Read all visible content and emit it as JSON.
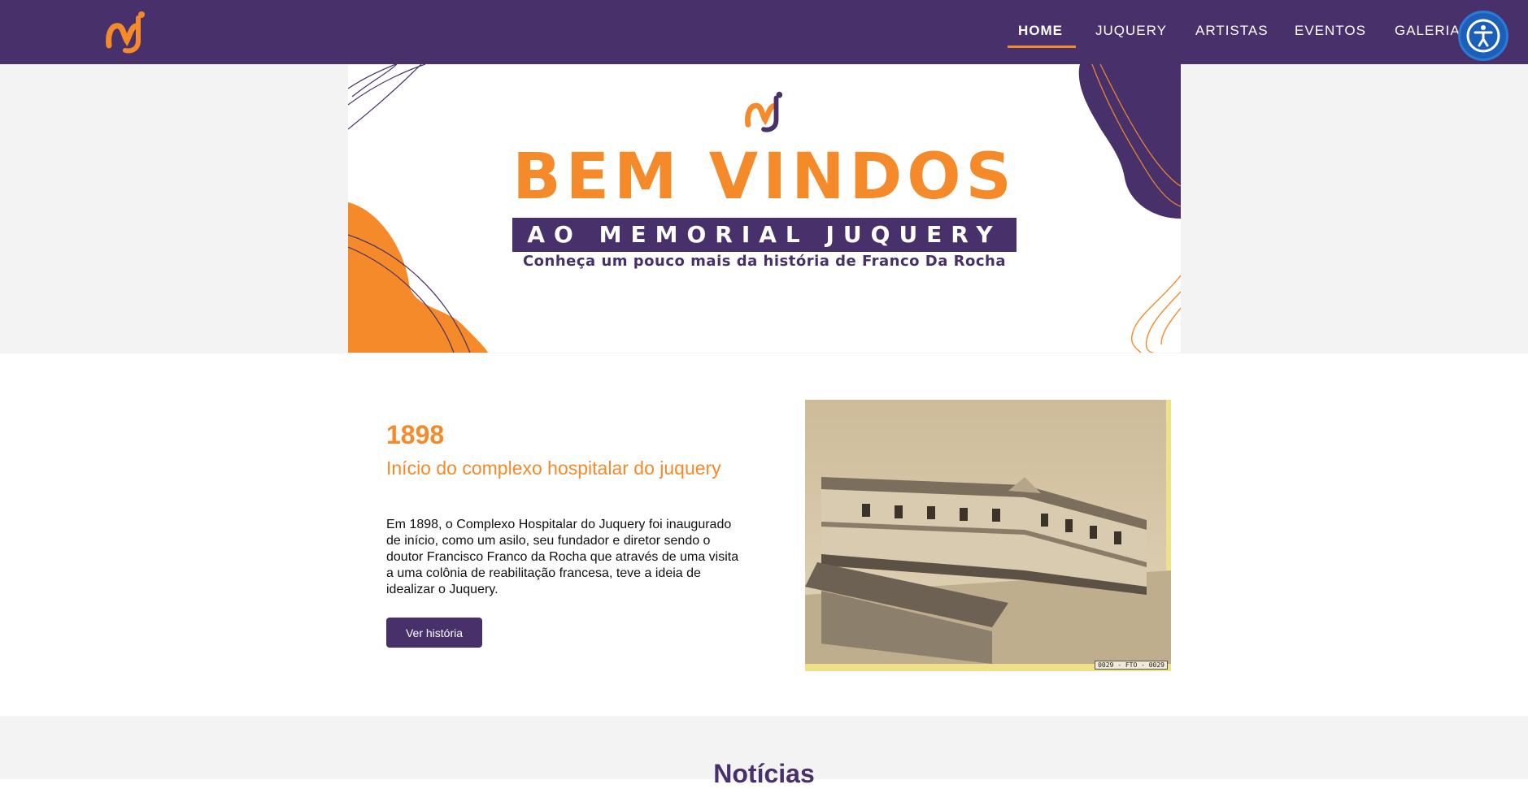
{
  "nav": {
    "logo_alt": "MJ",
    "items": [
      {
        "label": "HOME",
        "active": true
      },
      {
        "label": "JUQUERY",
        "active": false
      },
      {
        "label": "ARTISTAS",
        "active": false
      },
      {
        "label": "EVENTOS",
        "active": false
      },
      {
        "label": "GALERIA",
        "active": false
      }
    ],
    "accessibility_icon": "accessibility-icon"
  },
  "hero": {
    "title": "BEM VINDOS",
    "subtitle": "AO MEMORIAL JUQUERY",
    "tagline": "Conheça um pouco mais da história de Franco Da Rocha"
  },
  "feature": {
    "year": "1898",
    "subtitle": "Início do complexo hospitalar do juquery",
    "body": "Em 1898, o Complexo Hospitalar do Juquery foi inaugurado de início, como um asilo, seu fundador e diretor sendo o doutor Francisco Franco da Rocha que através de uma visita a uma colônia de reabilitação francesa, teve a ideia de idealizar o Juquery.",
    "button_label": "Ver história",
    "photo_tag": "0029 - FTO - 0029"
  },
  "news": {
    "title": "Notícias"
  },
  "colors": {
    "purple": "#48316b",
    "orange": "#f58a2a",
    "accessibility_blue": "#1c5fb8"
  }
}
